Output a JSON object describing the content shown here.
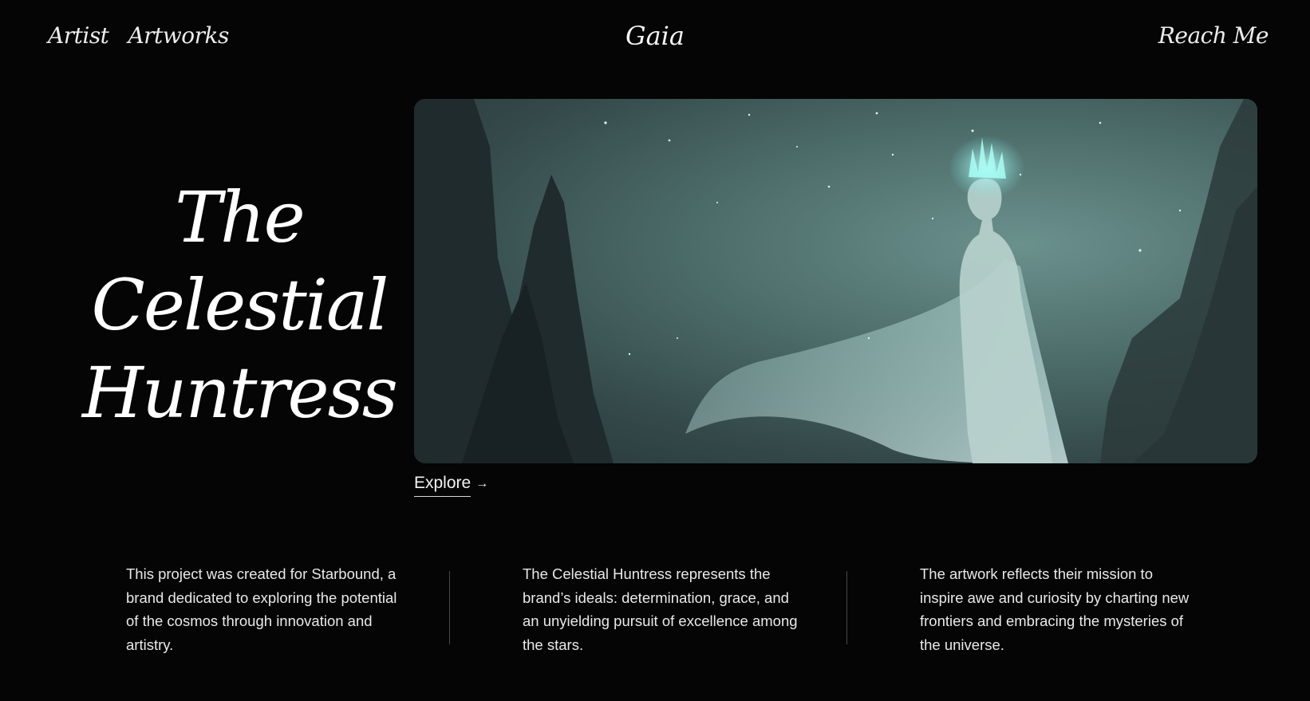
{
  "nav": {
    "left_links": [
      "Artist",
      "Artworks"
    ],
    "brand": "Gaia",
    "right_link": "Reach Me"
  },
  "hero": {
    "title_lines": [
      "The",
      "Celestial",
      "Huntress"
    ]
  },
  "explore": {
    "label": "Explore",
    "icon": "arrow-right-icon",
    "arrow": "→"
  },
  "columns": [
    "This project was created for Starbound, a brand dedicated to exploring the potential of the cosmos through innovation and artistry.",
    "The Celestial Huntress represents the brand’s ideals: determination, grace, and an unyielding pursuit of excellence among the stars.",
    "The artwork reflects their mission to inspire awe and curiosity by charting new frontiers and embracing the mysteries of the universe."
  ],
  "colors": {
    "background": "#050505",
    "text": "#f2f2f2",
    "art_glow": "#7fe6e0"
  }
}
